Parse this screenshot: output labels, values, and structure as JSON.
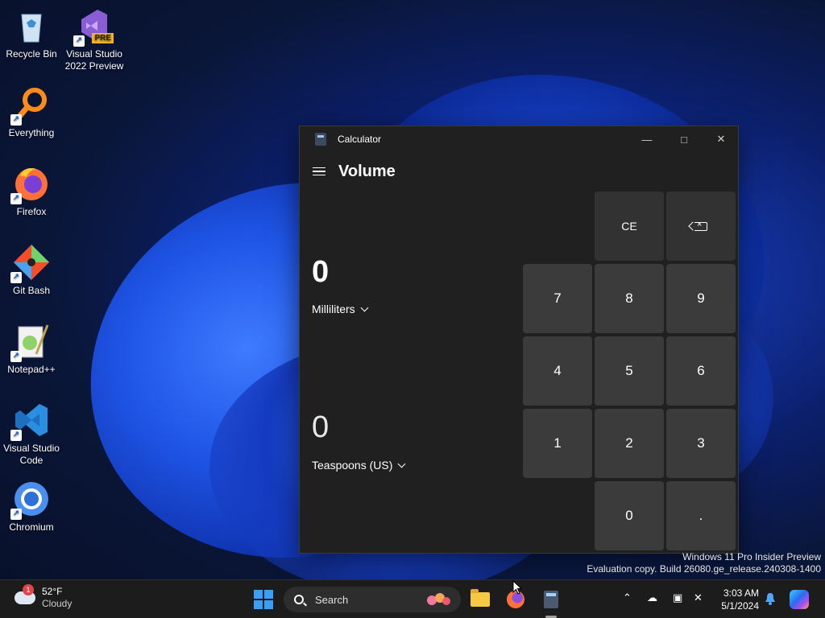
{
  "desktop": {
    "icons": [
      {
        "label": "Recycle Bin",
        "icon": "recycle-bin-icon"
      },
      {
        "label": "Visual Studio 2022 Preview",
        "icon": "visual-studio-icon",
        "badge": "PRE"
      },
      {
        "label": "Everything",
        "icon": "everything-search-icon"
      },
      {
        "label": "Firefox",
        "icon": "firefox-icon"
      },
      {
        "label": "Git Bash",
        "icon": "git-bash-icon"
      },
      {
        "label": "Notepad++",
        "icon": "notepad-plus-plus-icon"
      },
      {
        "label": "Visual Studio Code",
        "icon": "vscode-icon"
      },
      {
        "label": "Chromium",
        "icon": "chromium-icon"
      }
    ]
  },
  "calculator": {
    "window_title": "Calculator",
    "mode": "Volume",
    "input_value": "0",
    "input_unit": "Milliliters",
    "output_value": "0",
    "output_unit": "Teaspoons (US)",
    "keys": {
      "ce": "CE",
      "k7": "7",
      "k8": "8",
      "k9": "9",
      "k4": "4",
      "k5": "5",
      "k6": "6",
      "k1": "1",
      "k2": "2",
      "k3": "3",
      "k0": "0",
      "dot": "."
    },
    "colors": {
      "background": "#202020",
      "key": "#3b3b3b",
      "key_op": "#323232"
    }
  },
  "watermark": {
    "line1": "Windows 11 Pro Insider Preview",
    "line2": "Evaluation copy. Build 26080.ge_release.240308-1400"
  },
  "taskbar": {
    "weather": {
      "temp": "52°F",
      "condition": "Cloudy",
      "badge": "1"
    },
    "search_placeholder": "Search",
    "clock": {
      "time": "3:03 AM",
      "date": "5/1/2024"
    },
    "accent": "#3aa0f7"
  }
}
